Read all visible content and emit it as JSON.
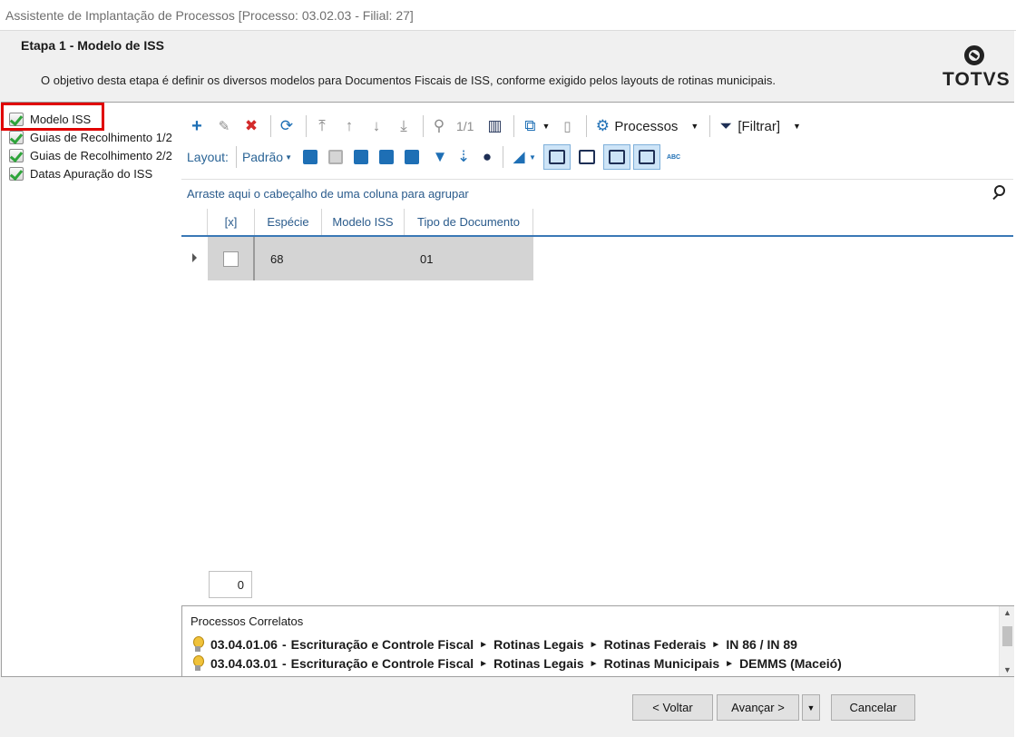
{
  "window": {
    "title": "Assistente de Implantação de Processos [Processo: 03.02.03 - Filial: 27]"
  },
  "header": {
    "step_title": "Etapa 1 - Modelo de ISS",
    "description": "O objetivo desta etapa é definir os diversos modelos para Documentos Fiscais de ISS, conforme exigido pelos layouts de rotinas municipais.",
    "logo_text": "TOTVS"
  },
  "steps": [
    {
      "label": "Modelo ISS"
    },
    {
      "label": "Guias de Recolhimento 1/2"
    },
    {
      "label": "Guias de Recolhimento 2/2"
    },
    {
      "label": "Datas Apuração do ISS"
    }
  ],
  "toolbar": {
    "page_indicator": "1/1",
    "processos_label": "Processos",
    "filtrar_label": "[Filtrar]",
    "layout_label": "Layout:",
    "layout_value": "Padrão"
  },
  "grid": {
    "group_hint": "Arraste aqui o cabeçalho de uma coluna para agrupar",
    "columns": [
      "[x]",
      "Espécie",
      "Modelo ISS",
      "Tipo de Documento"
    ],
    "rows": [
      {
        "checked": false,
        "especie": "68",
        "modelo_iss": "",
        "tipo_documento": "01"
      }
    ],
    "record_count": "0"
  },
  "correlatos": {
    "title": "Processos Correlatos",
    "items": [
      {
        "code": "03.04.01.06",
        "path": [
          "Escrituração e Controle Fiscal",
          "Rotinas Legais",
          "Rotinas Federais",
          "IN 86 / IN 89"
        ]
      },
      {
        "code": "03.04.03.01",
        "path": [
          "Escrituração e Controle Fiscal",
          "Rotinas Legais",
          "Rotinas Municipais",
          "DEMMS (Maceió)"
        ]
      }
    ]
  },
  "buttons": {
    "back": "< Voltar",
    "next": "Avançar >",
    "cancel": "Cancelar"
  }
}
